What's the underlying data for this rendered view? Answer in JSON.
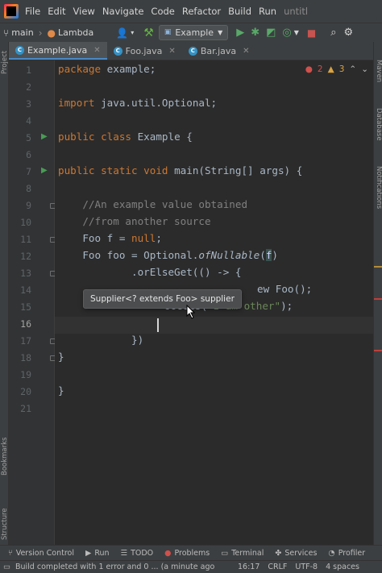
{
  "menubar": {
    "items": [
      "File",
      "Edit",
      "View",
      "Navigate",
      "Code",
      "Refactor",
      "Build",
      "Run",
      "untitl"
    ]
  },
  "toolbar": {
    "branch": "main",
    "lambda": "Lambda",
    "run_config": "Example"
  },
  "tabs": [
    {
      "label": "Example.java",
      "active": true
    },
    {
      "label": "Foo.java",
      "active": false
    },
    {
      "label": "Bar.java",
      "active": false
    }
  ],
  "side_labels": {
    "project": "Project",
    "bookmarks": "Bookmarks",
    "structure": "Structure",
    "maven": "Maven",
    "database": "Database",
    "notifications": "Notifications"
  },
  "inspections": {
    "errors": "2",
    "warnings": "3"
  },
  "line_numbers": [
    "1",
    "2",
    "3",
    "4",
    "5",
    "6",
    "7",
    "8",
    "9",
    "10",
    "11",
    "12",
    "13",
    "14",
    "15",
    "16",
    "17",
    "18",
    "19",
    "20",
    "21"
  ],
  "code": {
    "l1_kw": "package",
    "l1_rest": " example;",
    "l3_kw": "import",
    "l3_rest": " java.util.Optional;",
    "l5_kw": "public class",
    "l5_rest": " Example {",
    "l7_kw": "public static void",
    "l7_rest": " main(String[] args) {",
    "l9": "    //An example value obtained",
    "l10": "    //from another source",
    "l11_a": "    Foo f = ",
    "l11_kw": "null",
    "l11_b": ";",
    "l12_a": "    Foo foo = Optional.",
    "l12_it": "ofNullable",
    "l12_b": "(",
    "l12_p": "f",
    "l12_c": ")",
    "l13": "            .orElseGet(() -> {",
    "l14_a": "ew Foo();",
    "l15_a": "ooGets(",
    "l15_str": "\"I am other\"",
    "l15_b": ");",
    "l17": "            })",
    "l18": "}",
    "l20": "}"
  },
  "tooltip": "Supplier<? extends Foo> supplier",
  "bottom_tools": [
    "Version Control",
    "Run",
    "TODO",
    "Problems",
    "Terminal",
    "Services",
    "Profiler"
  ],
  "status": {
    "message": "Build completed with 1 error and 0 ... (a minute ago",
    "position": "16:17",
    "line_sep": "CRLF",
    "encoding": "UTF-8",
    "indent": "4 spaces"
  }
}
